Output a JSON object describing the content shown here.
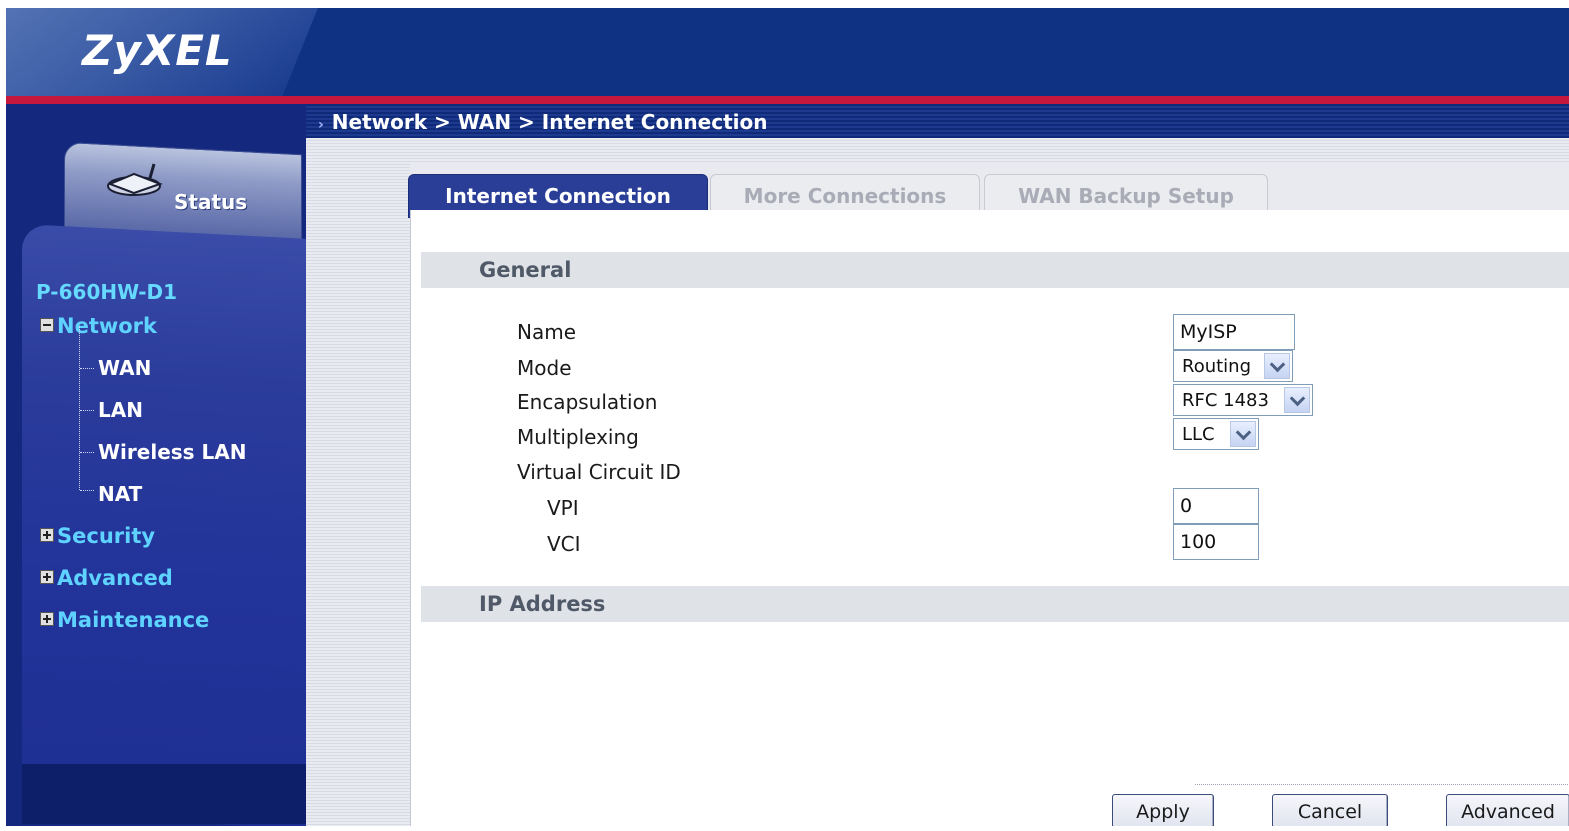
{
  "brand": {
    "logo_text": "ZyXEL"
  },
  "sidebar": {
    "status_label": "Status",
    "model": "P-660HW-D1",
    "tree": {
      "network": "Network",
      "wan": "WAN",
      "lan": "LAN",
      "wireless_lan": "Wireless LAN",
      "nat": "NAT",
      "security": "Security",
      "advanced": "Advanced",
      "maintenance": "Maintenance"
    }
  },
  "breadcrumb": "Network > WAN > Internet Connection",
  "tabs": {
    "internet_connection": "Internet Connection",
    "more_connections": "More Connections",
    "wan_backup_setup": "WAN Backup Setup"
  },
  "sections": {
    "general": "General",
    "ip_address": "IP Address"
  },
  "form": {
    "name_label": "Name",
    "name_value": "MyISP",
    "mode_label": "Mode",
    "mode_value": "Routing",
    "encapsulation_label": "Encapsulation",
    "encapsulation_value": "RFC 1483",
    "multiplexing_label": "Multiplexing",
    "multiplexing_value": "LLC",
    "vc_label": "Virtual Circuit ID",
    "vpi_label": "VPI",
    "vpi_value": "0",
    "vci_label": "VCI",
    "vci_value": "100"
  },
  "buttons": {
    "apply": "Apply",
    "cancel": "Cancel",
    "advanced": "Advanced"
  },
  "colors": {
    "header": "#0f3283",
    "accent_red": "#c5183c",
    "sidebar": "#14297e",
    "tree_link": "#5fd3ff"
  }
}
